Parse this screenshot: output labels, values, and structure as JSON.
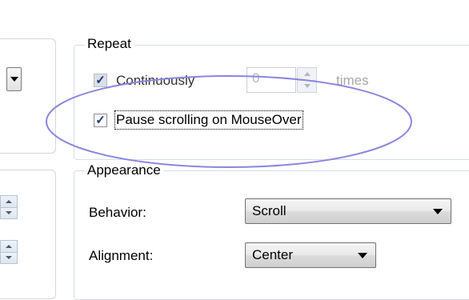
{
  "repeat": {
    "title": "Repeat",
    "continuously_label": "Continuously",
    "count_value": "0",
    "times_label": "times",
    "pause_label": "Pause scrolling on MouseOver"
  },
  "appearance": {
    "title": "Appearance",
    "behavior_label": "Behavior:",
    "behavior_value": "Scroll",
    "alignment_label": "Alignment:",
    "alignment_value": "Center"
  },
  "colors": {
    "highlight_ellipse": "#8a86e0",
    "groupbox_border": "#d5dfe5"
  },
  "icons": {
    "checkmark": "✓"
  }
}
